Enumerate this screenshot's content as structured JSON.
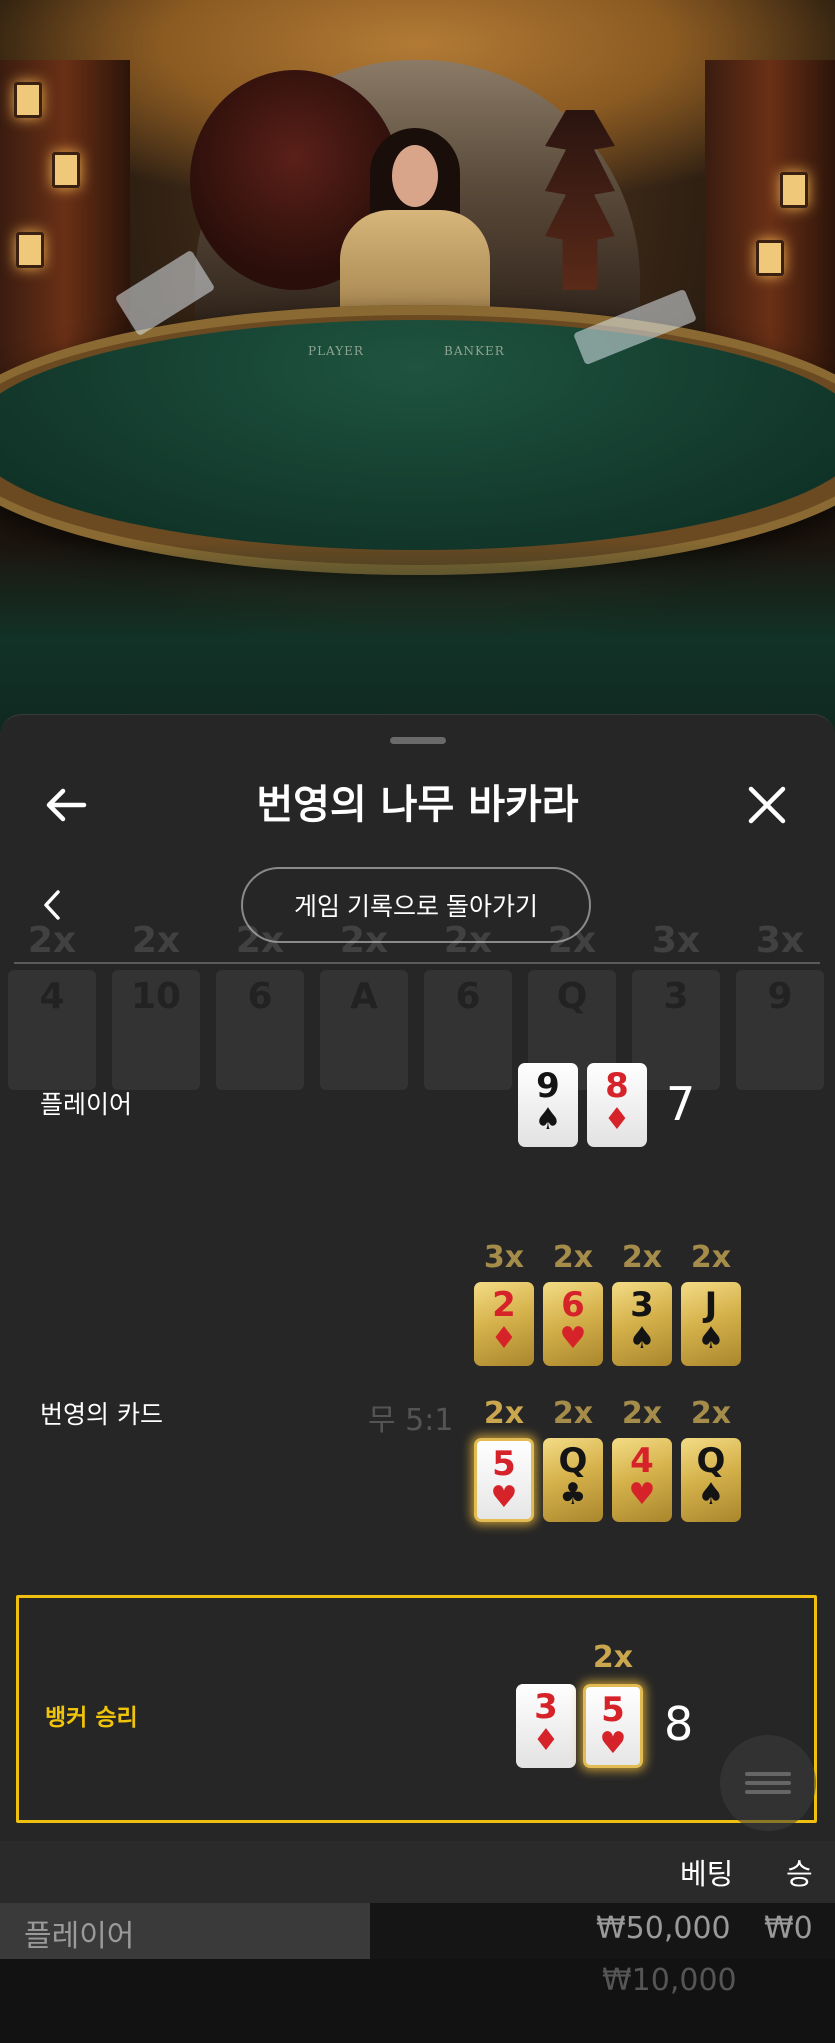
{
  "scene": {
    "felt_player": "PLAYER",
    "felt_banker": "BANKER"
  },
  "header": {
    "title": "번영의 나무 바카라",
    "back_icon": "arrow-left-icon",
    "close_icon": "close-icon"
  },
  "subheader": {
    "chevron_icon": "chevron-left-icon",
    "history_button": "게임 기록으로 돌아가기"
  },
  "background_road": {
    "multipliers": [
      "2x",
      "2x",
      "2x",
      "2x",
      "2x",
      "2x",
      "3x",
      "3x"
    ],
    "cards": [
      "4",
      "10",
      "6",
      "A",
      "6",
      "Q",
      "3",
      "9"
    ],
    "ghost_texts": [
      "무 5:1",
      "번영의 나무 바카라"
    ]
  },
  "player_row": {
    "label": "플레이어",
    "cards": [
      {
        "rank": "9",
        "suit": "♠",
        "color": "black"
      },
      {
        "rank": "8",
        "suit": "♦",
        "color": "red"
      }
    ],
    "score": "7"
  },
  "prosperity_row": {
    "label": "번영의 카드",
    "top_multipliers": [
      "3x",
      "2x",
      "2x",
      "2x"
    ],
    "top_cards": [
      {
        "rank": "2",
        "suit": "♦",
        "color": "red"
      },
      {
        "rank": "6",
        "suit": "♥",
        "color": "red"
      },
      {
        "rank": "3",
        "suit": "♠",
        "color": "black"
      },
      {
        "rank": "J",
        "suit": "♠",
        "color": "black"
      }
    ],
    "bottom_multipliers": [
      "2x",
      "2x",
      "2x",
      "2x"
    ],
    "bottom_cards": [
      {
        "rank": "5",
        "suit": "♥",
        "color": "red"
      },
      {
        "rank": "Q",
        "suit": "♣",
        "color": "black"
      },
      {
        "rank": "4",
        "suit": "♥",
        "color": "red"
      },
      {
        "rank": "Q",
        "suit": "♠",
        "color": "black"
      }
    ]
  },
  "banker_row": {
    "label": "뱅커 승리",
    "multiplier": "2x",
    "cards": [
      {
        "rank": "3",
        "suit": "♦",
        "color": "red"
      },
      {
        "rank": "5",
        "suit": "♥",
        "color": "red"
      }
    ],
    "score": "8"
  },
  "bets": {
    "headers": {
      "bet": "베팅",
      "win": "승"
    },
    "rows": [
      {
        "name": "플레이어",
        "bet": "₩50,000",
        "win": "₩0"
      },
      {
        "name": "",
        "bet": "₩10,000",
        "win": ""
      }
    ]
  },
  "colors": {
    "accent_gold": "#f0c010",
    "card_red": "#d6232a",
    "sheet_bg": "#262626"
  }
}
